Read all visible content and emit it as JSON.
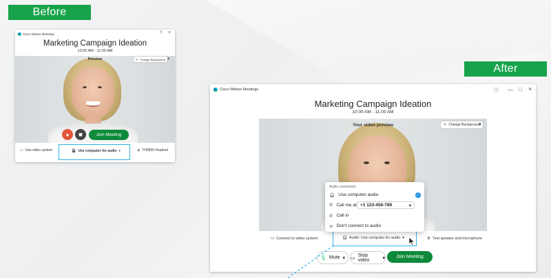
{
  "labels": {
    "before": "Before",
    "after": "After"
  },
  "app_name": "Cisco Webex Meetings",
  "meeting": {
    "title": "Marketing Campaign Ideation",
    "time": "10:00 AM - 11:00 AM"
  },
  "before": {
    "preview_label": "Preview",
    "change_background": "Change Background",
    "join_label": "Join Meeting",
    "video_system": "Use video system",
    "audio_option": "Use computer for audio",
    "headset": "TH0800 Headset"
  },
  "after": {
    "preview_label": "Your video preview",
    "change_background": "Change Background",
    "connect_video": "Connect to video system",
    "audio_button": "Audio: Use computer for audio",
    "test_speaker": "Test speaker and microphone",
    "mute_label": "Mute",
    "stop_video_label": "Stop video",
    "join_label": "Join Meeting",
    "audio_menu": {
      "header": "Audio connection",
      "use_computer": "Use computer audio",
      "call_me_at": "Call me at",
      "phone_number": "+1 123-456-789",
      "call_in": "Call in",
      "dont_connect": "Don't connect to audio"
    }
  },
  "colors": {
    "join_green": "#0d8a3a",
    "badge_green": "#16a34a",
    "highlight": "#2fb3e6",
    "check_blue": "#1e90e0"
  }
}
